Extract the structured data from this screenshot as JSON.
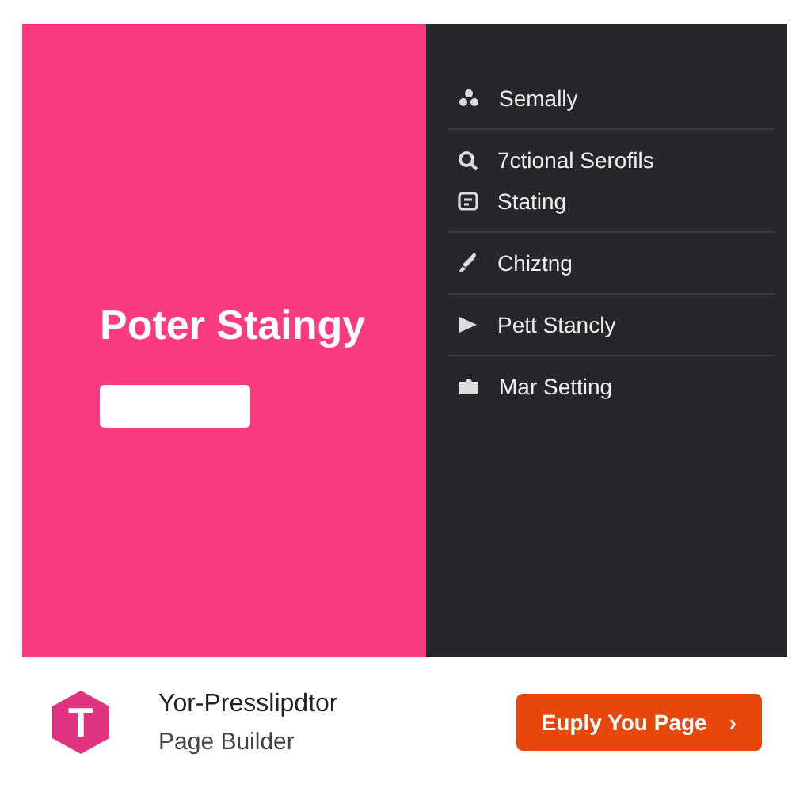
{
  "hero": {
    "title": "Poter Staingy"
  },
  "menu": {
    "groups": [
      {
        "items": [
          "Semally"
        ]
      },
      {
        "items": [
          "7ctional Serofils",
          "Stating"
        ]
      },
      {
        "items": [
          "Chiztng"
        ]
      },
      {
        "items": [
          "Pett Stancly"
        ]
      },
      {
        "items": [
          "Mar Setting"
        ]
      }
    ]
  },
  "footer": {
    "app_name": "Yor-Presslipdtor",
    "subtitle": "Page Builder",
    "logo_letter": "T",
    "action": {
      "label": "Euply You Page",
      "arrow": "›"
    }
  }
}
